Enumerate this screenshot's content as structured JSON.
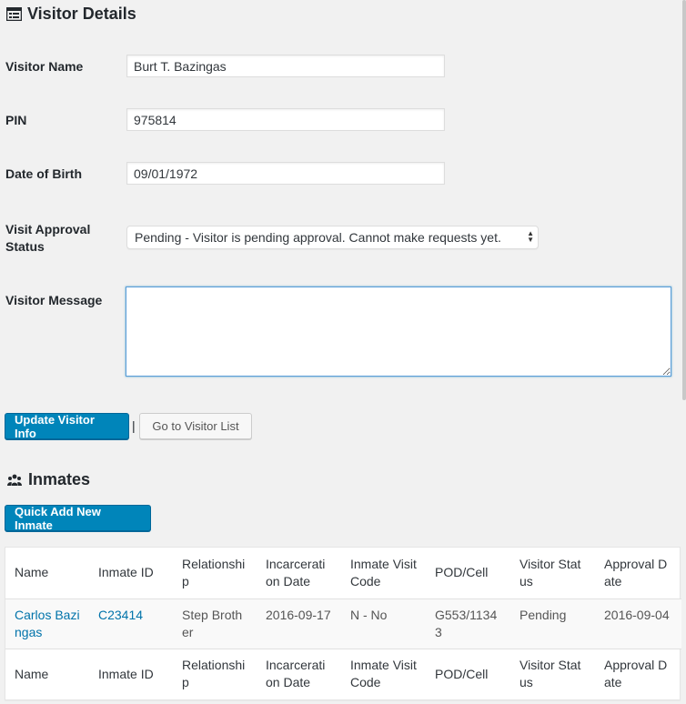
{
  "visitor_details": {
    "title": "Visitor Details",
    "fields": {
      "name_label": "Visitor Name",
      "name_value": "Burt T. Bazingas",
      "pin_label": "PIN",
      "pin_value": "975814",
      "dob_label": "Date of Birth",
      "dob_value": "09/01/1972",
      "status_label_1": "Visit Approval",
      "status_label_2": "Status",
      "status_value": "Pending - Visitor is pending approval. Cannot make requests yet.",
      "message_label": "Visitor Message",
      "message_value": ""
    },
    "update_button": "Update Visitor Info",
    "separator": "|",
    "list_button": "Go to Visitor List"
  },
  "inmates": {
    "title": "Inmates",
    "quick_add_button": "Quick Add New Inmate",
    "columns": [
      "Name",
      "Inmate ID",
      "Relationship",
      "Incarceration Date",
      "Inmate Visit Code",
      "POD/Cell",
      "Visitor Status",
      "Approval Date"
    ],
    "rows": [
      {
        "name": "Carlos Bazingas",
        "inmate_id": "C23414",
        "relationship": "Step Brother",
        "incarceration_date": "2016-09-17",
        "visit_code": "N - No",
        "pod_cell": "G553/11343",
        "visitor_status": "Pending",
        "approval_date": "2016-09-04"
      }
    ]
  }
}
